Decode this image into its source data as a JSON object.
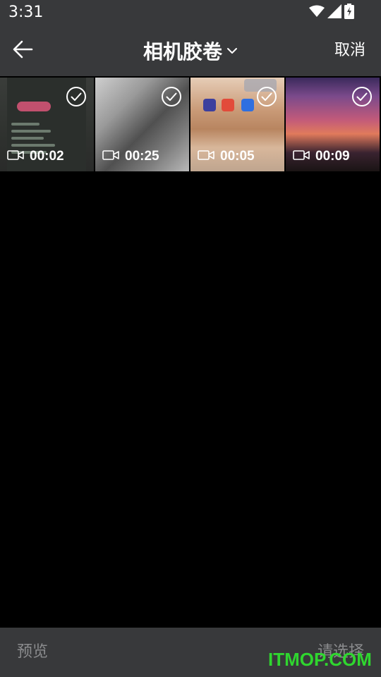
{
  "status_bar": {
    "time": "3:31",
    "icons": [
      "wifi-icon",
      "cellular-signal-icon",
      "battery-charging-icon"
    ]
  },
  "header": {
    "title": "相机胶卷",
    "cancel_label": "取消",
    "icons": [
      "back-arrow-icon",
      "chevron-down-icon"
    ]
  },
  "media_grid": {
    "items": [
      {
        "type": "video",
        "duration": "00:02",
        "selected": true
      },
      {
        "type": "video",
        "duration": "00:25",
        "selected": true
      },
      {
        "type": "video",
        "duration": "00:05",
        "selected": true
      },
      {
        "type": "video",
        "duration": "00:09",
        "selected": true
      }
    ]
  },
  "bottom_bar": {
    "preview_label": "预览",
    "select_label": "请选择"
  },
  "watermark": "ITMOP.COM",
  "colors": {
    "bar_background": "#38393b",
    "page_background": "#000000",
    "disabled_text": "#8a8b8d",
    "watermark": "#2fd62f"
  }
}
